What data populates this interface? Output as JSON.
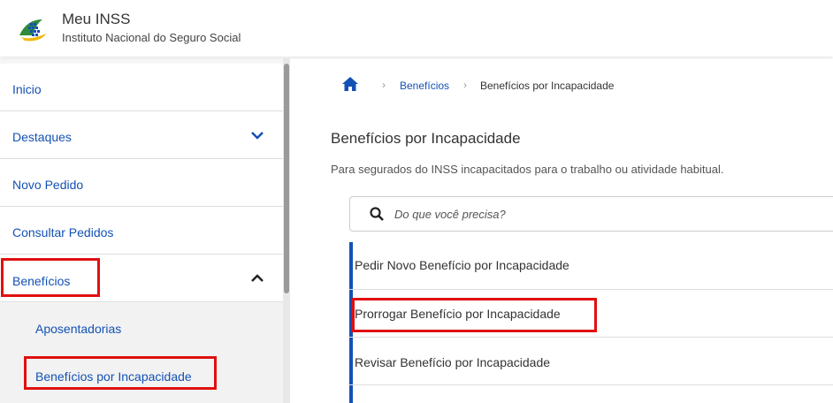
{
  "header": {
    "app_title": "Meu INSS",
    "app_subtitle": "Instituto Nacional do Seguro Social"
  },
  "sidebar": {
    "items": [
      {
        "label": "Inicio",
        "expandable": false
      },
      {
        "label": "Destaques",
        "expandable": true,
        "expanded": false
      },
      {
        "label": "Novo Pedido",
        "expandable": false
      },
      {
        "label": "Consultar Pedidos",
        "expandable": false
      },
      {
        "label": "Benefícios",
        "expandable": true,
        "expanded": true
      }
    ],
    "subitems": [
      {
        "label": "Aposentadorias"
      },
      {
        "label": "Benefícios por Incapacidade"
      }
    ]
  },
  "breadcrumb": {
    "home_icon": "home-icon",
    "link": "Benefícios",
    "current": "Benefícios por Incapacidade"
  },
  "main": {
    "title": "Benefícios por Incapacidade",
    "description": "Para segurados do INSS incapacitados para o trabalho ou atividade habitual."
  },
  "search": {
    "placeholder": "Do que você precisa?",
    "value": ""
  },
  "services": [
    {
      "label": "Pedir Novo Benefício por Incapacidade"
    },
    {
      "label": "Prorrogar Benefício por Incapacidade"
    },
    {
      "label": "Revisar Benefício por Incapacidade"
    }
  ],
  "colors": {
    "link_blue": "#1351b4",
    "highlight_red": "#e01010",
    "logo_green": "#2e8b3a",
    "logo_yellow": "#f2b705",
    "logo_blue": "#1351b4"
  }
}
